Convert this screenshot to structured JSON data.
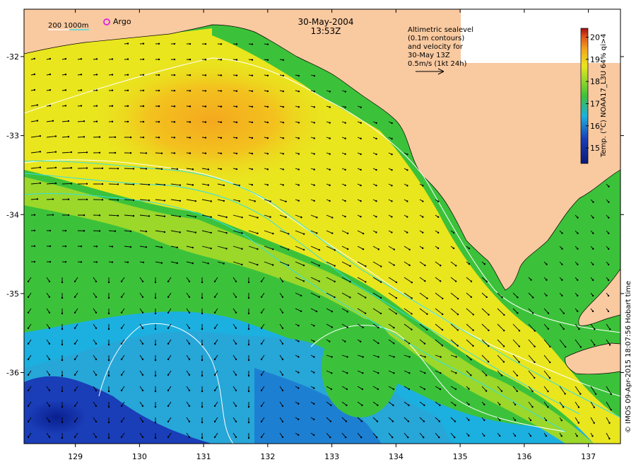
{
  "header": {
    "date": "30-May-2004",
    "time": "13:53Z"
  },
  "legend": {
    "isobath_label": "200  1000m",
    "argo_label": "Argo",
    "altimetry_lines": [
      "Altimetric sealevel",
      "(0.1m contours)",
      "and velocity for",
      "30-May 13Z",
      "0.5m/s (1kt 24h)"
    ]
  },
  "colorbar": {
    "ticks": [
      "15",
      "16",
      "17",
      "18",
      "19",
      "20"
    ],
    "title": "Temp. (°C) NOAA17_L3U 64% qi>4",
    "min": 14.3,
    "max": 20.4
  },
  "axes": {
    "x_ticks": [
      "129",
      "130",
      "131",
      "132",
      "133",
      "134",
      "135",
      "136",
      "137"
    ],
    "y_ticks": [
      "-32",
      "-33",
      "-34",
      "-35",
      "-36"
    ],
    "x_range": [
      128.2,
      137.5
    ],
    "y_range": [
      -36.9,
      -31.4
    ]
  },
  "credit": "© IMOS 09-Apr-2015 18:07:56 Hobart time",
  "colors": {
    "land": "#f9c9a0",
    "sst_warm": "#f4a81e",
    "sst_mid": "#e9e61e",
    "sst_green": "#3cc23a",
    "sst_cool": "#1bb0e0",
    "sst_cold": "#1a3db8",
    "isobath": "#ffffff",
    "altimetry": "#30e0e8",
    "argo": "#e020e0"
  }
}
